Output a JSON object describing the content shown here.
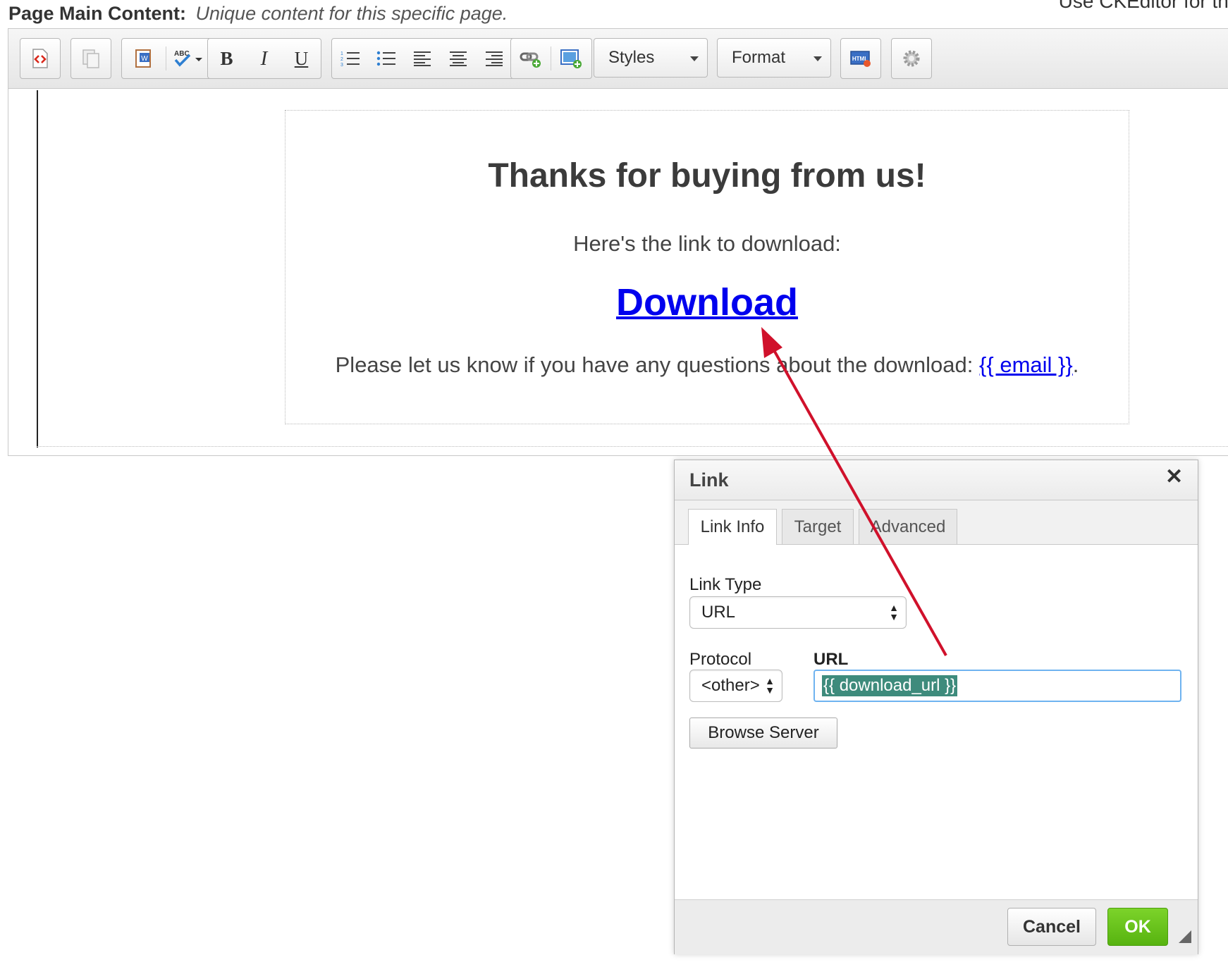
{
  "header": {
    "label": "Page Main Content:",
    "description": "Unique content for this specific page.",
    "top_right_text": "Use CKEditor for this pa"
  },
  "toolbar": {
    "styles_label": "Styles",
    "format_label": "Format",
    "buttons": [
      {
        "icon": "source-icon"
      },
      {
        "icon": "paste-icon"
      },
      {
        "icon": "paste-from-word-icon"
      },
      {
        "icon": "spellcheck-icon"
      },
      {
        "icon": "bold-icon"
      },
      {
        "icon": "italic-icon"
      },
      {
        "icon": "underline-icon"
      },
      {
        "icon": "numbered-list-icon"
      },
      {
        "icon": "bulleted-list-icon"
      },
      {
        "icon": "align-left-icon"
      },
      {
        "icon": "align-center-icon"
      },
      {
        "icon": "align-right-icon"
      },
      {
        "icon": "link-icon"
      },
      {
        "icon": "image-icon"
      },
      {
        "icon": "html-icon"
      },
      {
        "icon": "settings-icon"
      }
    ]
  },
  "content": {
    "title": "Thanks for buying from us!",
    "subtitle": "Here's the link to download:",
    "download_link": "Download",
    "note_prefix": "Please let us know if you have any questions about the download: ",
    "email_link": "{{ email }}",
    "note_suffix": "."
  },
  "dialog": {
    "title": "Link",
    "close_icon": "close-icon",
    "tabs": [
      {
        "label": "Link Info",
        "active": true
      },
      {
        "label": "Target",
        "active": false
      },
      {
        "label": "Advanced",
        "active": false
      }
    ],
    "link_type_label": "Link Type",
    "link_type_value": "URL",
    "protocol_label": "Protocol",
    "protocol_value": "<other>",
    "url_label": "URL",
    "url_value": "{{ download_url }}",
    "browse_button": "Browse Server",
    "cancel_button": "Cancel",
    "ok_button": "OK"
  },
  "colors": {
    "link": "#0000ee",
    "ok_button": "#6cc51f",
    "annotation_arrow": "#d0112b",
    "url_highlight": "#3e8b7c"
  }
}
